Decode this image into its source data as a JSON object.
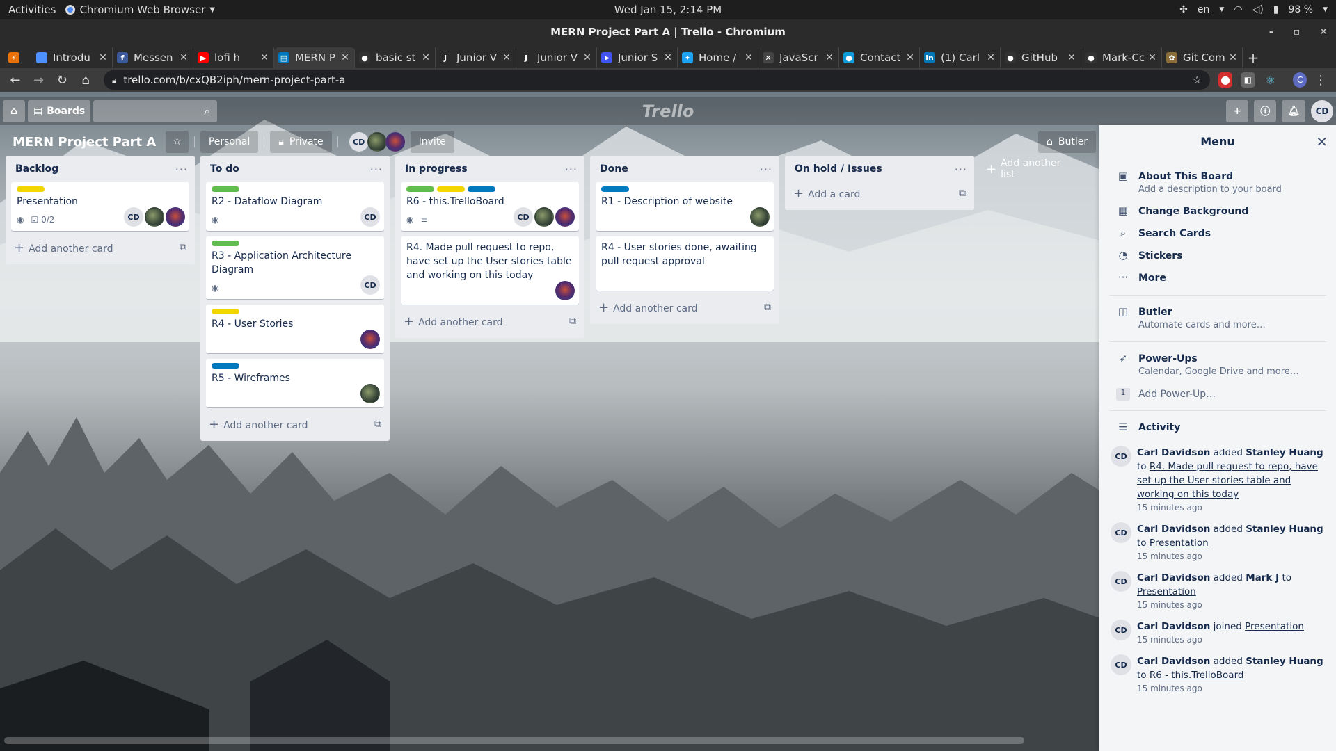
{
  "system_bar": {
    "activities": "Activities",
    "app_name": "Chromium Web Browser",
    "clock": "Wed Jan 15,  2:14 PM",
    "lang": "en",
    "battery": "98 %"
  },
  "window": {
    "title": "MERN Project Part A | Trello - Chromium"
  },
  "tabs": [
    {
      "title": "Introdu",
      "fav": "",
      "favcolor": "#4d90fe"
    },
    {
      "title": "Messen",
      "fav": "f",
      "favcolor": "#3b5998"
    },
    {
      "title": "lofi h",
      "fav": "▶",
      "favcolor": "#ff0000"
    },
    {
      "title": "MERN P",
      "fav": "▤",
      "favcolor": "#0079bf"
    },
    {
      "title": "basic st",
      "fav": "●",
      "favcolor": "#333333"
    },
    {
      "title": "Junior V",
      "fav": "J",
      "favcolor": "#2b2b2b"
    },
    {
      "title": "Junior V",
      "fav": "J",
      "favcolor": "#2b2b2b"
    },
    {
      "title": "Junior S",
      "fav": "➤",
      "favcolor": "#4154f1"
    },
    {
      "title": "Home /",
      "fav": "✦",
      "favcolor": "#1da1f2"
    },
    {
      "title": "JavaScr",
      "fav": "✕",
      "favcolor": "#444444"
    },
    {
      "title": "Contact",
      "fav": "●",
      "favcolor": "#0f9bd7"
    },
    {
      "title": "(1) Carl",
      "fav": "in",
      "favcolor": "#0077b5"
    },
    {
      "title": "GitHub",
      "fav": "●",
      "favcolor": "#333333"
    },
    {
      "title": "Mark-Cc",
      "fav": "●",
      "favcolor": "#333333"
    },
    {
      "title": "Git Com",
      "fav": "✿",
      "favcolor": "#8a6d3b"
    }
  ],
  "address_bar": {
    "url": "trello.com/b/cxQB2iph/mern-project-part-a"
  },
  "trello_header": {
    "boards_label": "Boards",
    "logo": "Trello",
    "me_initials": "CD"
  },
  "board": {
    "title": "MERN Project Part A",
    "team": "Personal",
    "visibility": "Private",
    "invite": "Invite",
    "butler": "Butler",
    "add_list": "Add another list"
  },
  "lists": [
    {
      "title": "Backlog",
      "add_label": "Add another card",
      "cards": [
        {
          "title": "Presentation",
          "labels": [
            "#f2d600"
          ],
          "badges": {
            "watch": true,
            "checklist": "0/2"
          },
          "members": [
            "CD",
            "p1",
            "p2"
          ]
        }
      ]
    },
    {
      "title": "To do",
      "add_label": "Add another card",
      "cards": [
        {
          "title": "R2 - Dataflow Diagram",
          "labels": [
            "#61bd4f"
          ],
          "badges": {
            "watch": true
          },
          "members": [
            "CD"
          ]
        },
        {
          "title": "R3 - Application Architecture Diagram",
          "labels": [
            "#61bd4f"
          ],
          "badges": {
            "watch": true
          },
          "members": [
            "CD"
          ]
        },
        {
          "title": "R4 - User Stories",
          "labels": [
            "#f2d600"
          ],
          "badges": {},
          "members": [
            "p2"
          ]
        },
        {
          "title": "R5 - Wireframes",
          "labels": [
            "#0079bf"
          ],
          "badges": {},
          "members": [
            "p1"
          ]
        }
      ]
    },
    {
      "title": "In progress",
      "add_label": "Add another card",
      "cards": [
        {
          "title": "R6 - this.TrelloBoard",
          "labels": [
            "#61bd4f",
            "#f2d600",
            "#0079bf"
          ],
          "badges": {
            "watch": true,
            "desc": true
          },
          "members": [
            "CD",
            "p1",
            "p2"
          ]
        },
        {
          "title": "R4. Made pull request to repo, have set up the User stories table and working on this today",
          "labels": [],
          "badges": {},
          "members": [
            "p2"
          ]
        }
      ]
    },
    {
      "title": "Done",
      "add_label": "Add another card",
      "cards": [
        {
          "title": "R1 - Description of website",
          "labels": [
            "#0079bf"
          ],
          "badges": {},
          "members": [
            "p1"
          ]
        },
        {
          "title": "R4 - User stories done, awaiting pull request approval",
          "labels": [],
          "badges": {},
          "members": []
        }
      ]
    },
    {
      "title": "On hold / Issues",
      "add_label": "Add a card",
      "cards": []
    }
  ],
  "menu": {
    "title": "Menu",
    "items": [
      {
        "icon": "board-icon",
        "glyph": "▣",
        "title": "About This Board",
        "sub": "Add a description to your board"
      },
      {
        "icon": "background-icon",
        "glyph": "▦",
        "title": "Change Background",
        "sub": ""
      },
      {
        "icon": "search-icon",
        "glyph": "⌕",
        "title": "Search Cards",
        "sub": ""
      },
      {
        "icon": "sticker-icon",
        "glyph": "◔",
        "title": "Stickers",
        "sub": ""
      },
      {
        "icon": "more-icon",
        "glyph": "···",
        "title": "More",
        "sub": ""
      }
    ],
    "butler": {
      "title": "Butler",
      "sub": "Automate cards and more…"
    },
    "powerups": {
      "title": "Power-Ups",
      "sub": "Calendar, Google Drive and more…",
      "count": "1",
      "add": "Add Power-Up…"
    },
    "activity_title": "Activity",
    "activity": [
      {
        "user": "Carl Davidson",
        "verb": "added",
        "target": "Stanley Huang",
        "prep": "to",
        "card": "R4. Made pull request to repo, have set up the User stories table and working on this today",
        "time": "15 minutes ago"
      },
      {
        "user": "Carl Davidson",
        "verb": "added",
        "target": "Stanley Huang",
        "prep": "to",
        "card": "Presentation",
        "time": "15 minutes ago"
      },
      {
        "user": "Carl Davidson",
        "verb": "added",
        "target": "Mark J",
        "prep": "to",
        "card": "Presentation",
        "time": "15 minutes ago"
      },
      {
        "user": "Carl Davidson",
        "verb": "joined",
        "target": "",
        "prep": "",
        "card": "Presentation",
        "time": "15 minutes ago"
      },
      {
        "user": "Carl Davidson",
        "verb": "added",
        "target": "Stanley Huang",
        "prep": "to",
        "card": "R6 - this.TrelloBoard",
        "time": "15 minutes ago"
      }
    ]
  }
}
